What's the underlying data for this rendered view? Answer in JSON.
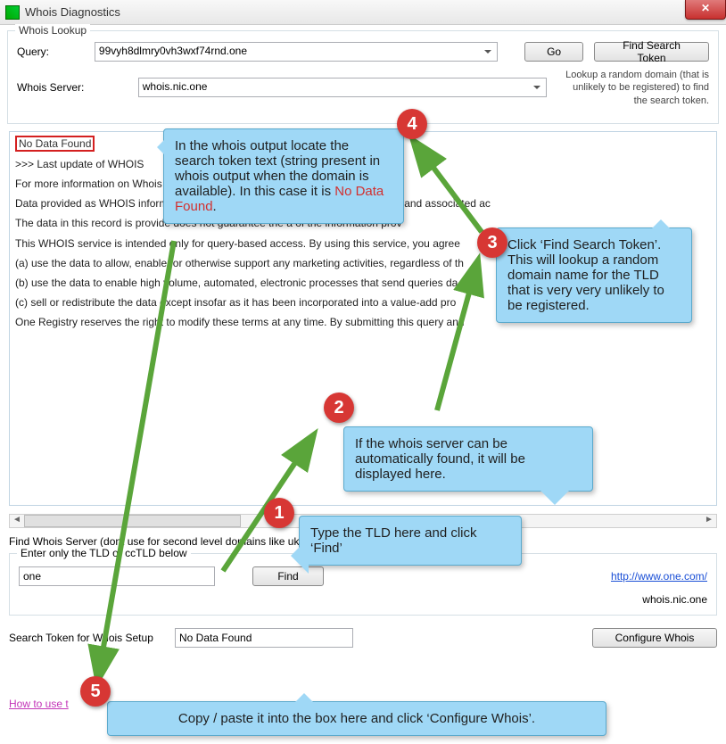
{
  "window": {
    "title": "Whois Diagnostics",
    "close_glyph": "✕"
  },
  "lookup": {
    "legend": "Whois Lookup",
    "query_label": "Query:",
    "query_value": "99vyh8dlmry0vh3wxf74rnd.one",
    "server_label": "Whois Server:",
    "server_value": "whois.nic.one",
    "go_label": "Go",
    "find_token_label": "Find Search Token",
    "hint": "Lookup a random domain (that is unlikely to be registered) to find the search token."
  },
  "output": {
    "highlight": "No Data Found",
    "lines": [
      ">>> Last update of WHOIS",
      "For more information on Whois s",
      "Data provided as WHOIS information                                                              ontact information for a domain name          strant and associated ac",
      "The data in this record is provide                                                                          does not guarantee the a              of the information prov",
      "This WHOIS service is intended only for query-based access. By using this service, you agree",
      " (a) use the data to allow, enable, or otherwise support any marketing activities, regardless of th",
      " (b) use the data to enable high volume, automated, electronic processes that send queries    da",
      " (c) sell or redistribute the data except insofar as it has been incorporated into a value-add    pro",
      "One Registry reserves the right to modify these terms at any time. By submitting this query and"
    ]
  },
  "find_server": {
    "heading": "Find Whois Server (dont use for second level domains like uk.",
    "legend": "Enter only the TLD or ccTLD below",
    "tld_value": "one",
    "find_label": "Find",
    "link_text": "http://www.one.com/",
    "server_echo": "whois.nic.one"
  },
  "token_row": {
    "label": "Search Token for Whois Setup",
    "value": "No Data Found",
    "configure_label": "Configure Whois"
  },
  "howto_link": "How to use t",
  "annotations": {
    "c1": "Type the TLD here and click ‘Find’",
    "c2": "If the whois server can be automatically found, it will be displayed here.",
    "c3": "Click ‘Find Search Token’. This will lookup a random domain name for the TLD that is very very unlikely to be registered.",
    "c4a": "In the whois output locate the search token text (string present in whois output when the domain is available). In this case it is ",
    "c4b": "No Data Found",
    "c4c": ".",
    "c5": "Copy / paste it into the box here and click ‘Configure Whois’."
  },
  "badges": {
    "b1": "1",
    "b2": "2",
    "b3": "3",
    "b4": "4",
    "b5": "5"
  }
}
